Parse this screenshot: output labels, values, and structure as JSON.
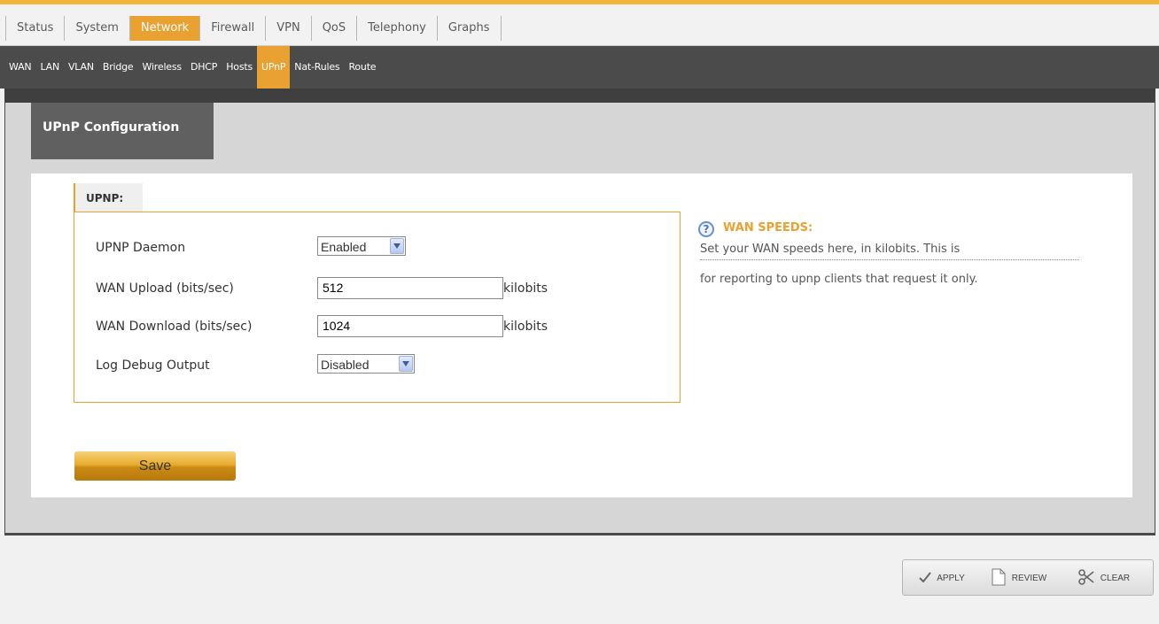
{
  "main_nav": {
    "items": [
      "Status",
      "System",
      "Network",
      "Firewall",
      "VPN",
      "QoS",
      "Telephony",
      "Graphs"
    ],
    "active": "Network",
    "accent_color": "#e9a231"
  },
  "sub_nav": {
    "items": [
      "WAN",
      "LAN",
      "VLAN",
      "Bridge",
      "Wireless",
      "DHCP",
      "Hosts",
      "UPnP",
      "Nat-Rules",
      "Route"
    ],
    "active": "UPnP"
  },
  "page": {
    "section_title": "UPnP Configuration"
  },
  "upnp": {
    "legend": "UPNP:",
    "daemon": {
      "label": "UPNP Daemon",
      "value": "Enabled"
    },
    "wan_upload": {
      "label": "WAN Upload (bits/sec)",
      "value": "512",
      "unit": "kilobits"
    },
    "wan_download": {
      "label": "WAN Download (bits/sec)",
      "value": "1024",
      "unit": "kilobits"
    },
    "log_debug": {
      "label": "Log Debug Output",
      "value": "Disabled"
    },
    "save_label": "Save"
  },
  "help": {
    "icon": "question-circle-icon",
    "title": "WAN SPEEDS:",
    "line1": "Set your WAN speeds here, in kilobits. This is",
    "line2": "for reporting to upnp clients that request it only."
  },
  "footer": {
    "apply_label": "APPLY",
    "review_label": "REVIEW",
    "clear_label": "CLEAR"
  }
}
